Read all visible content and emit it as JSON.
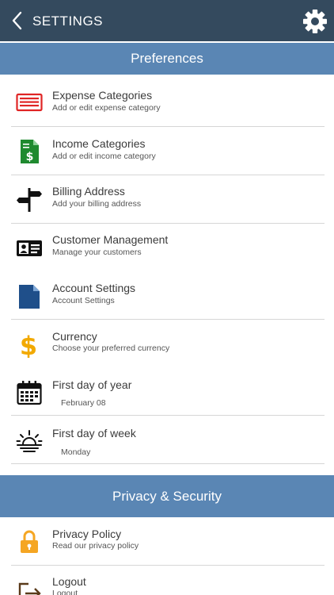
{
  "header": {
    "title": "SETTINGS",
    "back_icon": "chevron-left-icon",
    "settings_icon": "gear-icon"
  },
  "sections": {
    "preferences": "Preferences",
    "privacy": "Privacy & Security"
  },
  "preferences_items": [
    {
      "title": "Expense Categories",
      "subtitle": "Add or edit expense category",
      "icon": "expense-list-icon",
      "color": "#e02424"
    },
    {
      "title": "Income Categories",
      "subtitle": "Add or edit income category",
      "icon": "income-document-icon",
      "color": "#1f8a2f"
    },
    {
      "title": "Billing Address",
      "subtitle": "Add your billing address",
      "icon": "signpost-icon",
      "color": "#111111"
    },
    {
      "title": "Customer Management",
      "subtitle": "Manage your customers",
      "icon": "id-card-icon",
      "color": "#111111"
    },
    {
      "title": "Account Settings",
      "subtitle": "Account Settings",
      "icon": "document-icon",
      "color": "#1f4f8a"
    },
    {
      "title": "Currency",
      "subtitle": "Choose your preferred currency",
      "icon": "dollar-icon",
      "color": "#f2a900"
    },
    {
      "title": "First day of year",
      "subtitle": "February 08",
      "icon": "calendar-icon",
      "color": "#111111"
    },
    {
      "title": "First day of week",
      "subtitle": "Monday",
      "icon": "sunrise-icon",
      "color": "#111111"
    }
  ],
  "privacy_items": [
    {
      "title": "Privacy Policy",
      "subtitle": "Read our privacy policy",
      "icon": "lock-icon",
      "color": "#f5a623"
    },
    {
      "title": "Logout",
      "subtitle": "Logout",
      "icon": "logout-icon",
      "color": "#5a3a1a"
    }
  ],
  "colors": {
    "topbar": "#344a5e",
    "section_header": "#5a86b4"
  }
}
